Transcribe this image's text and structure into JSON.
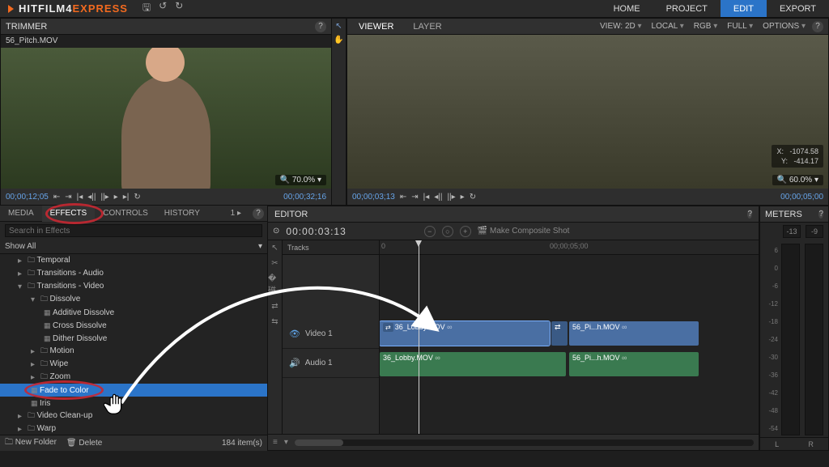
{
  "app": {
    "logo_prefix": "HITFILM4",
    "logo_suffix": "EXPRESS"
  },
  "topnav": {
    "home": "HOME",
    "project": "PROJECT",
    "edit": "EDIT",
    "export": "EXPORT"
  },
  "trimmer": {
    "title": "TRIMMER",
    "clipname": "56_Pitch.MOV",
    "zoom": "70.0%",
    "tc_left": "00;00;12;05",
    "tc_right": "00;00;32;16"
  },
  "viewer": {
    "tab_viewer": "VIEWER",
    "tab_layer": "LAYER",
    "view_mode": "VIEW: 2D",
    "space": "LOCAL",
    "channels": "RGB",
    "quality": "FULL",
    "options": "OPTIONS",
    "coord_x_label": "X:",
    "coord_x": "-1074.58",
    "coord_y_label": "Y:",
    "coord_y": "-414.17",
    "zoom": "60.0%",
    "tc_left": "00;00;03;13",
    "tc_right": "00;00;05;00"
  },
  "left_tabs": {
    "media": "MEDIA",
    "effects": "EFFECTS",
    "controls": "CONTROLS",
    "history": "HISTORY",
    "overflow": "1 ▸"
  },
  "effects": {
    "search_placeholder": "Search in Effects",
    "show_all": "Show All",
    "tree": {
      "temporal": "Temporal",
      "trans_audio": "Transitions - Audio",
      "trans_video": "Transitions - Video",
      "dissolve": "Dissolve",
      "additive": "Additive Dissolve",
      "cross": "Cross Dissolve",
      "dither": "Dither Dissolve",
      "motion": "Motion",
      "wipe": "Wipe",
      "zoom": "Zoom",
      "fade": "Fade to Color",
      "iris": "Iris",
      "cleanup": "Video Clean-up",
      "warp": "Warp"
    },
    "footer": {
      "new_folder": "New Folder",
      "delete": "Delete",
      "count": "184 item(s)"
    }
  },
  "editor": {
    "title": "EDITOR",
    "tc": "00:00:03:13",
    "make_comp": "Make Composite Shot",
    "tracks_label": "Tracks",
    "ruler": {
      "t0": "0",
      "t1": "00;00;05;00"
    },
    "video_track": "Video 1",
    "audio_track": "Audio 1",
    "clip_v1": "36_Lobby.MOV",
    "clip_v2": "56_Pi...h.MOV",
    "clip_a1": "36_Lobby.MOV",
    "clip_a2": "56_Pi...h.MOV"
  },
  "meters": {
    "title": "METERS",
    "peak_l": "-13",
    "peak_r": "-9",
    "scale": [
      "6",
      "0",
      "-6",
      "-12",
      "-18",
      "-24",
      "-30",
      "-36",
      "-42",
      "-48",
      "-54"
    ],
    "L": "L",
    "R": "R"
  }
}
